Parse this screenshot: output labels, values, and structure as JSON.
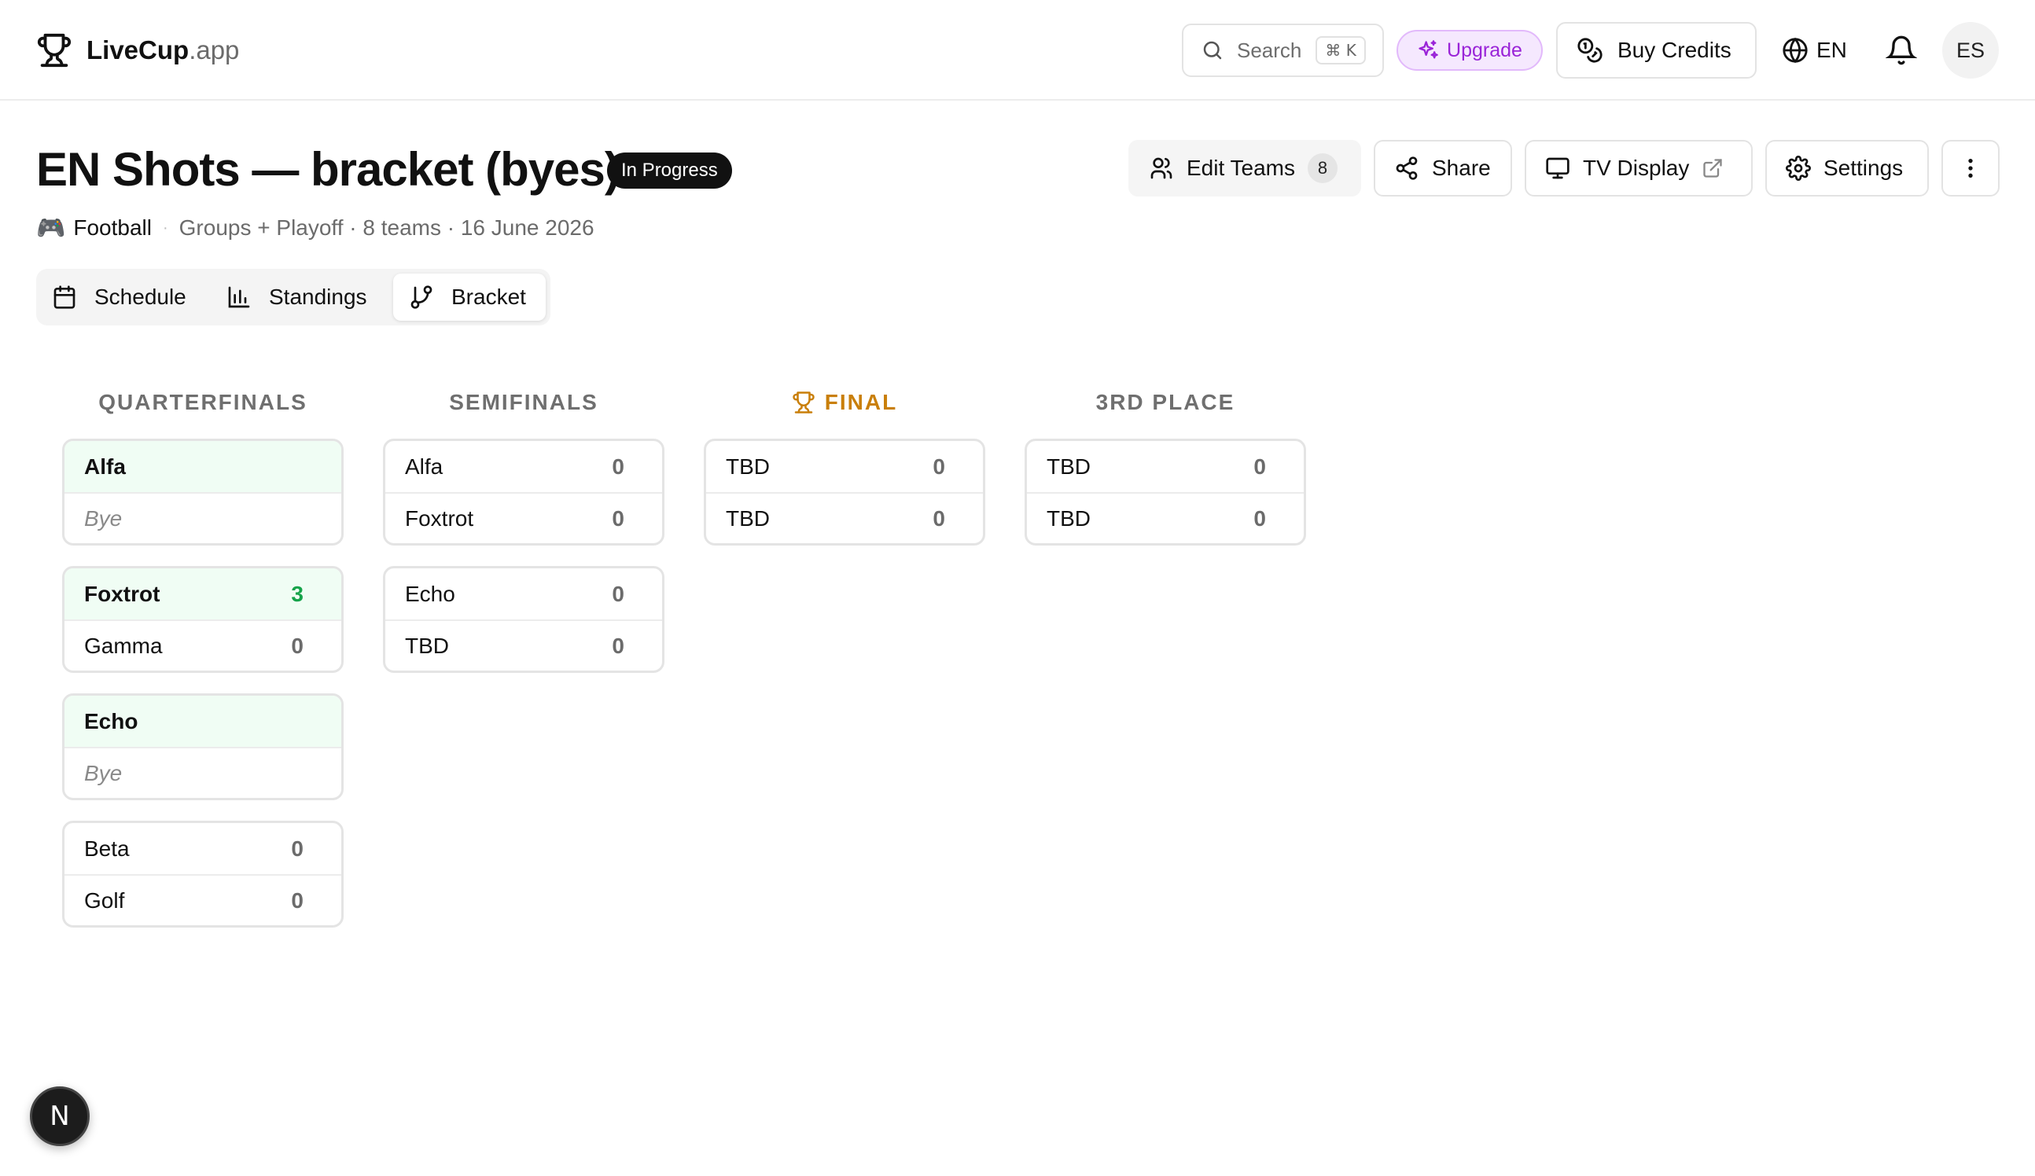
{
  "header": {
    "brand": "LiveCup",
    "brand_suffix": ".app",
    "search_placeholder": "Search",
    "search_shortcut": "⌘ K",
    "upgrade_label": "Upgrade",
    "credits_label": "Buy Credits",
    "language": "EN",
    "avatar_initials": "ES"
  },
  "tournament": {
    "title": "EN Shots — bracket (byes)",
    "status": "In Progress",
    "sport_emoji": "🎮",
    "sport": "Football",
    "info": "Groups + Playoff · 8 teams · 16 June 2026"
  },
  "actions": {
    "edit_teams_label": "Edit Teams",
    "edit_teams_count": "8",
    "share_label": "Share",
    "tv_display_label": "TV Display",
    "settings_label": "Settings"
  },
  "tabs": [
    {
      "label": "Schedule"
    },
    {
      "label": "Standings"
    },
    {
      "label": "Bracket"
    }
  ],
  "bracket": {
    "rounds": [
      {
        "title": "QUARTERFINALS"
      },
      {
        "title": "SEMIFINALS"
      },
      {
        "title": "FINAL"
      },
      {
        "title": "3RD PLACE"
      }
    ],
    "quarterfinals": [
      {
        "home": {
          "name": "Alfa",
          "score": ""
        },
        "away": {
          "name": "Bye",
          "score": ""
        }
      },
      {
        "home": {
          "name": "Foxtrot",
          "score": "3"
        },
        "away": {
          "name": "Gamma",
          "score": "0"
        }
      },
      {
        "home": {
          "name": "Echo",
          "score": ""
        },
        "away": {
          "name": "Bye",
          "score": ""
        }
      },
      {
        "home": {
          "name": "Beta",
          "score": "0"
        },
        "away": {
          "name": "Golf",
          "score": "0"
        }
      }
    ],
    "semifinals": [
      {
        "home": {
          "name": "Alfa",
          "score": "0"
        },
        "away": {
          "name": "Foxtrot",
          "score": "0"
        }
      },
      {
        "home": {
          "name": "Echo",
          "score": "0"
        },
        "away": {
          "name": "TBD",
          "score": "0"
        }
      }
    ],
    "final": [
      {
        "home": {
          "name": "TBD",
          "score": "0"
        },
        "away": {
          "name": "TBD",
          "score": "0"
        }
      }
    ],
    "third_place": [
      {
        "home": {
          "name": "TBD",
          "score": "0"
        },
        "away": {
          "name": "TBD",
          "score": "0"
        }
      }
    ]
  },
  "dev_badge": "N",
  "colors": {
    "winner_bg": "#f0fdf4",
    "winner_score": "#16a34a",
    "final_accent": "#c97f0a",
    "upgrade_accent": "#9a24d8"
  }
}
